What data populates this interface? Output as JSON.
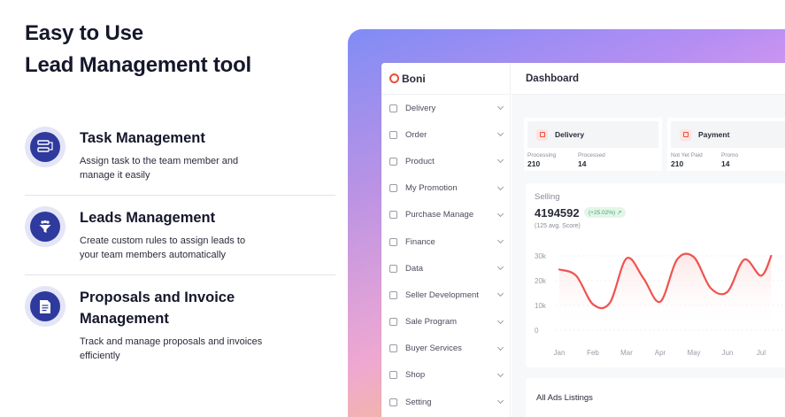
{
  "headline": {
    "line1": "Easy to Use",
    "line2": "Lead Management tool"
  },
  "features": [
    {
      "icon": "task-icon",
      "title": "Task Management",
      "description": "Assign task to the team member and manage it easily"
    },
    {
      "icon": "funnel-icon",
      "title": "Leads Management",
      "description": "Create custom rules to assign leads to your team members automatically"
    },
    {
      "icon": "invoice-icon",
      "title": "Proposals and Invoice Management",
      "description": "Track and manage proposals and invoices efficiently"
    }
  ],
  "dashboard": {
    "brand": "Boni",
    "page_title": "Dashboard",
    "nav": [
      {
        "label": "Delivery",
        "icon": "box-icon"
      },
      {
        "label": "Order",
        "icon": "order-icon"
      },
      {
        "label": "Product",
        "icon": "product-icon"
      },
      {
        "label": "My Promotion",
        "icon": "promotion-icon"
      },
      {
        "label": "Purchase Manage",
        "icon": "purchase-icon"
      },
      {
        "label": "Finance",
        "icon": "finance-icon"
      },
      {
        "label": "Data",
        "icon": "data-icon"
      },
      {
        "label": "Seller Development",
        "icon": "seller-icon"
      },
      {
        "label": "Sale Program",
        "icon": "sale-icon"
      },
      {
        "label": "Buyer Services",
        "icon": "buyer-icon"
      },
      {
        "label": "Shop",
        "icon": "shop-icon"
      },
      {
        "label": "Setting",
        "icon": "gear-icon"
      }
    ],
    "stats": [
      {
        "title": "Delivery",
        "icon": "delivery-icon",
        "items": [
          {
            "label": "Processing",
            "value": "210"
          },
          {
            "label": "Processed",
            "value": "14"
          }
        ]
      },
      {
        "title": "Payment",
        "icon": "payment-icon",
        "items": [
          {
            "label": "Not Yet Paid",
            "value": "210"
          },
          {
            "label": "Promo",
            "value": "14"
          }
        ]
      }
    ],
    "selling": {
      "title": "Selling",
      "value": "4194592",
      "badge": "(+25.02%) ↗",
      "sub": "(125 avg. Score)"
    },
    "ads_title": "All Ads Listings",
    "colors": {
      "accent": "#e8503a",
      "line": "#ef5350"
    }
  },
  "chart_data": {
    "type": "line",
    "categories": [
      "Jan",
      "Feb",
      "Mar",
      "Apr",
      "May",
      "Jun",
      "Jul"
    ],
    "yticks": [
      "30k",
      "20k",
      "10k",
      "0"
    ],
    "ylim": [
      0,
      30000
    ],
    "series": [
      {
        "x": [
          0,
          0.5,
          1,
          1.5,
          2,
          2.5,
          3,
          3.5,
          4,
          4.5,
          5,
          5.5,
          6,
          6.3
        ],
        "values": [
          24500,
          22000,
          10500,
          11000,
          29000,
          21000,
          11500,
          28500,
          29500,
          17000,
          15500,
          28500,
          22000,
          30000
        ]
      }
    ]
  }
}
